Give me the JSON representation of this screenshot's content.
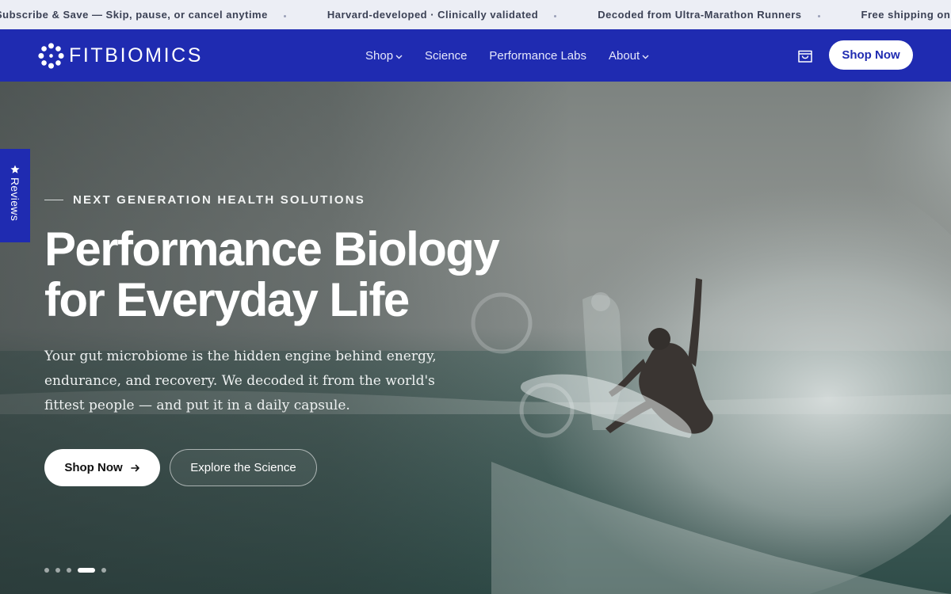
{
  "announcement": {
    "items": [
      "Subscribe & Save — Skip, pause, or cancel anytime",
      "Harvard-developed · Clinically validated",
      "Decoded from Ultra-Marathon Runners",
      "Free shipping on every order"
    ]
  },
  "header": {
    "brand": "FITBIOMICS",
    "nav": [
      {
        "label": "Shop",
        "has_dropdown": true
      },
      {
        "label": "Science",
        "has_dropdown": false
      },
      {
        "label": "Performance Labs",
        "has_dropdown": false
      },
      {
        "label": "About",
        "has_dropdown": true
      }
    ],
    "cart_icon": "shopping-bag-icon",
    "cta": "Shop Now"
  },
  "hero": {
    "eyebrow": "NEXT GENERATION HEALTH SOLUTIONS",
    "title_line1": "Performance Biology",
    "title_line2": "for Everyday Life",
    "body": "Your gut microbiome is the hidden engine behind energy, endurance, and recovery. We decoded it from the world's fittest people — and put it in a daily capsule.",
    "primary_cta": "Shop Now",
    "primary_cta_icon": "arrow-right-icon",
    "secondary_cta": "Explore the Science",
    "slides": {
      "count": 5,
      "active_index": 3
    }
  },
  "reviews_tab": {
    "label": "Reviews",
    "icon": "star-icon"
  },
  "colors": {
    "brand_blue": "#1f2bb1",
    "announcement_bg": "#eceef5",
    "white": "#ffffff"
  }
}
